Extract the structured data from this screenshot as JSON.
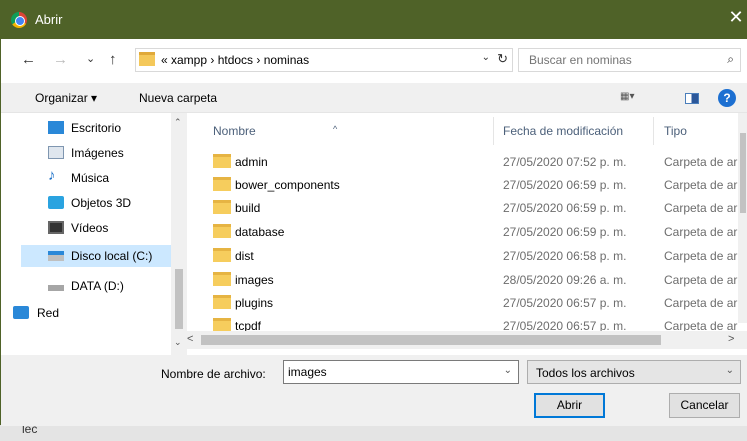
{
  "window": {
    "title": "Abrir",
    "close_glyph": "✕"
  },
  "address": {
    "back_glyph": "←",
    "forward_glyph": "→",
    "recent_glyph": "⌄",
    "up_glyph": "↑",
    "crumbs": "«  xampp  ›  htdocs  ›  nominas",
    "dropdown_glyph": "⌄",
    "refresh_glyph": "↻",
    "search_placeholder": "Buscar en nominas",
    "search_glyph": "⌕"
  },
  "toolbar": {
    "organize": "Organizar ▾",
    "new_folder": "Nueva carpeta",
    "view_glyph": "▦▾",
    "help_glyph": "?"
  },
  "sidebar": {
    "items": [
      {
        "label": "Escritorio",
        "icon": "desktop-icon"
      },
      {
        "label": "Imágenes",
        "icon": "pictures-icon"
      },
      {
        "label": "Música",
        "icon": "music-icon"
      },
      {
        "label": "Objetos 3D",
        "icon": "objects3d-icon"
      },
      {
        "label": "Vídeos",
        "icon": "videos-icon"
      },
      {
        "label": "Disco local (C:)",
        "icon": "drive-icon",
        "selected": true
      },
      {
        "label": "DATA (D:)",
        "icon": "drive-icon"
      },
      {
        "label": "Red",
        "icon": "network-icon"
      }
    ],
    "scroll_up": "⌃",
    "scroll_down": "⌄"
  },
  "columns": {
    "name": "Nombre",
    "date": "Fecha de modificación",
    "type": "Tipo",
    "sort_glyph": "^"
  },
  "files": [
    {
      "name": "admin",
      "date": "27/05/2020 07:52 p. m.",
      "type": "Carpeta de ar"
    },
    {
      "name": "bower_components",
      "date": "27/05/2020 06:59 p. m.",
      "type": "Carpeta de ar"
    },
    {
      "name": "build",
      "date": "27/05/2020 06:59 p. m.",
      "type": "Carpeta de ar"
    },
    {
      "name": "database",
      "date": "27/05/2020 06:59 p. m.",
      "type": "Carpeta de ar"
    },
    {
      "name": "dist",
      "date": "27/05/2020 06:58 p. m.",
      "type": "Carpeta de ar"
    },
    {
      "name": "images",
      "date": "28/05/2020 09:26 a. m.",
      "type": "Carpeta de ar"
    },
    {
      "name": "plugins",
      "date": "27/05/2020 06:57 p. m.",
      "type": "Carpeta de ar"
    },
    {
      "name": "tcpdf",
      "date": "27/05/2020 06:57 p. m.",
      "type": "Carpeta de ar"
    }
  ],
  "hscroll": {
    "left": "<",
    "right": ">"
  },
  "bottom": {
    "filename_label": "Nombre de archivo:",
    "filename_value": "images",
    "filter_value": "Todos los archivos",
    "dropdown_glyph": "⌄",
    "open_label": "Abrir",
    "cancel_label": "Cancelar"
  },
  "background": {
    "text": "lec"
  }
}
